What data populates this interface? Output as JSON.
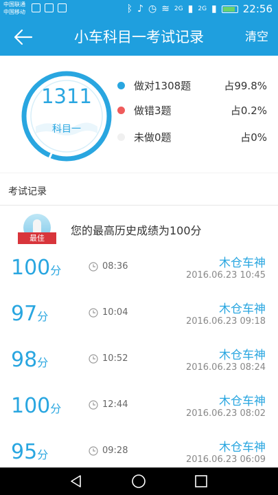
{
  "status_bar": {
    "carrier1": "中国联通",
    "carrier2": "中国移动",
    "net1": "2G",
    "net2": "2G",
    "time": "22:56"
  },
  "app_bar": {
    "title": "小车科目一考试记录",
    "clear_label": "清空"
  },
  "summary": {
    "count": "1311",
    "subject": "科目一",
    "legend": [
      {
        "text": "做对1308题",
        "pct": "占99.8%",
        "color": "#29a6e0"
      },
      {
        "text": "做错3题",
        "pct": "占0.2%",
        "color": "#ef5b5b"
      },
      {
        "text": "未做0题",
        "pct": "占0%",
        "color": "#f0f0f0"
      }
    ]
  },
  "records_section": {
    "title": "考试记录",
    "best_badge": "最佳",
    "best_text": "您的最高历史成绩为100分"
  },
  "records": [
    {
      "score": "100",
      "unit": "分",
      "duration": "08:36",
      "user": "木仓车神",
      "date": "2016.06.23  10:45"
    },
    {
      "score": "97",
      "unit": "分",
      "duration": "10:04",
      "user": "木仓车神",
      "date": "2016.06.23  09:18"
    },
    {
      "score": "98",
      "unit": "分",
      "duration": "10:52",
      "user": "木仓车神",
      "date": "2016.06.23  08:24"
    },
    {
      "score": "100",
      "unit": "分",
      "duration": "12:44",
      "user": "木仓车神",
      "date": "2016.06.23  08:02"
    },
    {
      "score": "95",
      "unit": "分",
      "duration": "09:28",
      "user": "木仓车神",
      "date": "2016.06.23  06:09"
    }
  ]
}
